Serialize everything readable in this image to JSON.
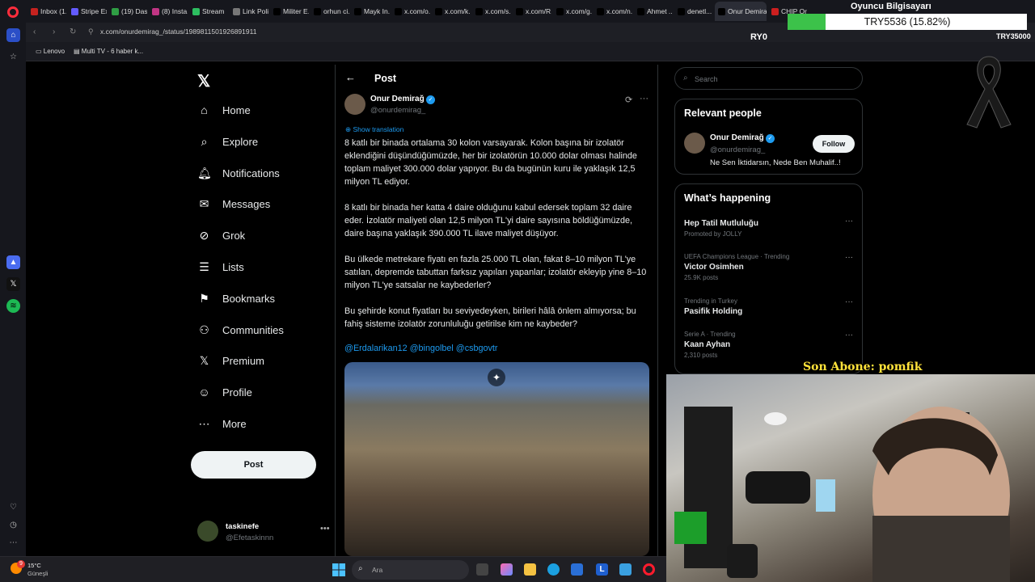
{
  "browser": {
    "tabs": [
      {
        "label": "Inbox (1...",
        "color": "#c5221f"
      },
      {
        "label": "Stripe Ex...",
        "color": "#635bff"
      },
      {
        "label": "(19) Das...",
        "color": "#2f9e44"
      },
      {
        "label": "(8) Insta...",
        "color": "#c13584"
      },
      {
        "label": "Stream",
        "color": "#2dbe60"
      },
      {
        "label": "Link Poli...",
        "color": "#777777"
      },
      {
        "label": "Militer E...",
        "color": "#000000"
      },
      {
        "label": "orhun ci...",
        "color": "#000000"
      },
      {
        "label": "Mayk In...",
        "color": "#000000"
      },
      {
        "label": "x.com/o...",
        "color": "#000000"
      },
      {
        "label": "x.com/k...",
        "color": "#000000"
      },
      {
        "label": "x.com/s...",
        "color": "#000000"
      },
      {
        "label": "x.com/R...",
        "color": "#000000"
      },
      {
        "label": "x.com/g...",
        "color": "#000000"
      },
      {
        "label": "x.com/n...",
        "color": "#000000"
      },
      {
        "label": "Ahmet ...",
        "color": "#000000"
      },
      {
        "label": "denetl...",
        "color": "#000000"
      },
      {
        "label": "Onur Demirağ",
        "color": "#000000",
        "active": true
      },
      {
        "label": "CHIP Or...",
        "color": "#cc1f1f"
      }
    ],
    "url": "x.com/onurdemirag_/status/1989811501926891911",
    "bookmarks": [
      "Lenovo",
      "Multi TV - 6 haber k..."
    ]
  },
  "overlay": {
    "title": "Oyuncu Bilgisayarı",
    "goal_text": "TRY5536 (15.82%)",
    "progress": 0.1582,
    "left_label": "RY0",
    "right_label": "TRY35000"
  },
  "x_nav": {
    "items": [
      {
        "label": "Home",
        "icon": "home-icon",
        "glyph": "⌂"
      },
      {
        "label": "Explore",
        "icon": "search-icon",
        "glyph": "⌕"
      },
      {
        "label": "Notifications",
        "icon": "bell-icon",
        "glyph": "🔔︎"
      },
      {
        "label": "Messages",
        "icon": "mail-icon",
        "glyph": "✉"
      },
      {
        "label": "Grok",
        "icon": "grok-icon",
        "glyph": "⊘"
      },
      {
        "label": "Lists",
        "icon": "list-icon",
        "glyph": "☰"
      },
      {
        "label": "Bookmarks",
        "icon": "bookmark-icon",
        "glyph": "⚑"
      },
      {
        "label": "Communities",
        "icon": "people-icon",
        "glyph": "⚇"
      },
      {
        "label": "Premium",
        "icon": "x-logo-icon",
        "glyph": "𝕏"
      },
      {
        "label": "Profile",
        "icon": "person-icon",
        "glyph": "☺"
      },
      {
        "label": "More",
        "icon": "more-circle-icon",
        "glyph": "⋯"
      }
    ],
    "post_button": "Post",
    "account": {
      "name": "taskinefe",
      "handle": "@Efetaskinnn"
    }
  },
  "post": {
    "header": "Post",
    "author": "Onur Demirağ",
    "handle": "@onurdemirag_",
    "show_translation": "Show translation",
    "paragraphs": [
      "8 katlı bir binada ortalama 30 kolon varsayarak. Kolon başına bir izolatör eklendiğini düşündüğümüzde, her bir izolatörün 10.000 dolar olması halinde toplam maliyet 300.000 dolar yapıyor. Bu da bugünün kuru ile yaklaşık 12,5 milyon TL ediyor.",
      "8 katlı bir binada her katta 4 daire olduğunu kabul edersek toplam 32 daire eder. İzolatör maliyeti olan 12,5 milyon TL'yi daire sayısına böldüğümüzde, daire başına yaklaşık 390.000 TL ilave maliyet düşüyor.",
      "Bu ülkede metrekare fiyatı en fazla 25.000 TL olan, fakat 8–10 milyon TL'ye satılan, depremde tabuttan farksız yapıları yapanlar; izolatör ekleyip yine 8–10 milyon TL'ye satsalar ne kaybederler?",
      "Bu şehirde konut fiyatları bu seviyedeyken, birileri hâlâ önlem almıyorsa; bu fahiş sisteme izolatör zorunluluğu getirilse kim ne kaybeder?"
    ],
    "mentions": "@Erdalarikan12 @bingolbel @csbgovtr"
  },
  "sidebar": {
    "search_placeholder": "Search",
    "relevant_title": "Relevant people",
    "person": {
      "name": "Onur Demirağ",
      "handle": "@onurdemirag_",
      "bio": "Ne Sen İktidarsın, Nede Ben Muhalif..!",
      "follow": "Follow"
    },
    "happening_title": "What’s happening",
    "trends": [
      {
        "title": "Hep Tatil Mutluluğu",
        "sub": "Promoted by JOLLY",
        "meta": ""
      },
      {
        "meta": "UEFA Champions League · Trending",
        "title": "Victor Osimhen",
        "sub": "25.9K posts"
      },
      {
        "meta": "Trending in Turkey",
        "title": "Pasifik Holding",
        "sub": ""
      },
      {
        "meta": "Serie A · Trending",
        "title": "Kaan Ayhan",
        "sub": "2,310 posts"
      }
    ]
  },
  "stream": {
    "last_subscriber": "Son Abone: pomfik"
  },
  "taskbar": {
    "temp": "15°C",
    "weather": "Güneşli",
    "notif_count": "9",
    "search_placeholder": "Ara"
  },
  "colors": {
    "accent": "#1d9bf0",
    "background": "#000000",
    "progress": "#3cc24a"
  }
}
